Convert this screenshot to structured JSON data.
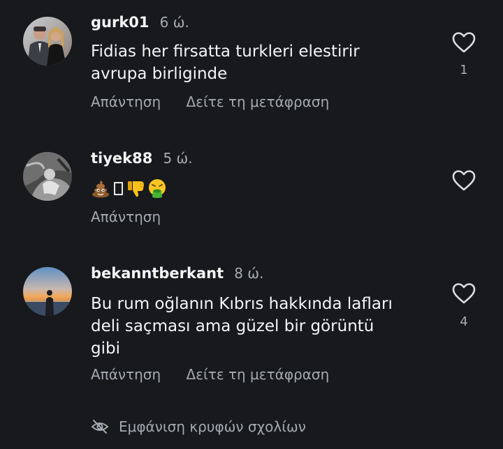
{
  "comments": [
    {
      "username": "gurk01",
      "time": "6 ώ.",
      "text_lines": [
        "Fidias her firsatta turkleri elestirir",
        "avrupa birliginde"
      ],
      "like_count": "1",
      "reply_label": "Απάντηση",
      "translate_label": "Δείτε τη μετάφραση",
      "avatar_icon": "couple-photo-avatar"
    },
    {
      "username": "tiyek88",
      "time": "5 ώ.",
      "emojis": [
        "pile-of-poo-icon",
        "missing-glyph-icon",
        "thumbs-down-icon",
        "vomiting-face-icon"
      ],
      "like_count": "",
      "reply_label": "Απάντηση",
      "avatar_icon": "monochrome-photo-avatar"
    },
    {
      "username": "bekanntberkant",
      "time": "8 ώ.",
      "text_lines": [
        "Bu rum oğlanın Kıbrıs hakkında lafları",
        "deli saçması ama güzel bir görüntü",
        "gibi"
      ],
      "like_count": "4",
      "reply_label": "Απάντηση",
      "translate_label": "Δείτε τη μετάφραση",
      "avatar_icon": "sunset-silhouette-avatar"
    }
  ],
  "hidden_comments": {
    "label": "Εμφάνιση κρυφών σχολίων",
    "icon": "eye-slash-icon"
  },
  "colors": {
    "background": "#17191d",
    "primary_text": "#f3f4f6",
    "secondary_text": "#a5a9b0",
    "heart_outline": "#dcdde0"
  }
}
